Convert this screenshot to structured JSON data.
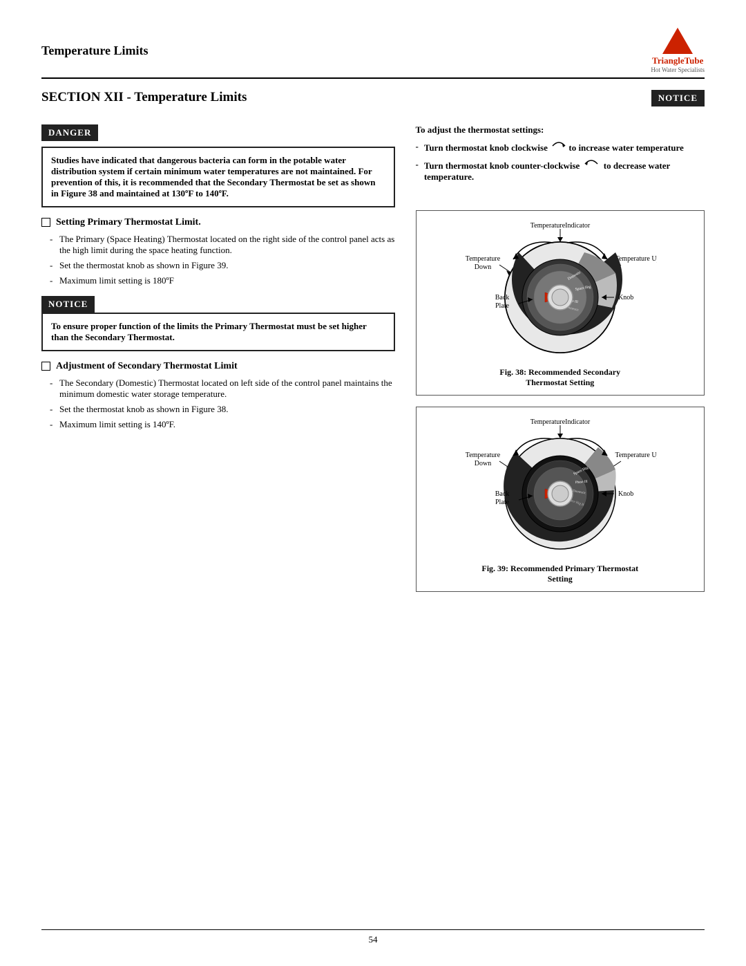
{
  "header": {
    "title": "Temperature Limits"
  },
  "logo": {
    "main": "TriangleTube",
    "sub": "Hot Water Specialists"
  },
  "section": {
    "title": "SECTION XII - Temperature Limits"
  },
  "danger": {
    "label": "DANGER",
    "text": "Studies have indicated that dangerous bacteria can form in the potable water distribution system if certain minimum water temperatures are not maintained. For prevention of this, it is recommended that the Secondary Thermostat be set as shown in Figure 38 and maintained at 130ºF to 140ºF."
  },
  "primary_setting": {
    "heading": "Setting  Primary Thermostat Limit.",
    "bullets": [
      "The Primary (Space Heating) Thermostat located on the right side of the control panel acts as the high limit during the space heating function.",
      "Set the thermostat knob as shown in Figure 39.",
      "Maximum limit setting is 180ºF"
    ]
  },
  "notice_left": {
    "label": "NOTICE",
    "text": "To ensure proper function of the limits the Primary Thermostat must be set higher than the Secondary Thermostat."
  },
  "secondary_adjustment": {
    "heading": "Adjustment of Secondary Thermostat Limit",
    "bullets": [
      "The Secondary (Domestic) Thermostat located on left side of the control panel maintains the minimum domestic water storage temperature.",
      "Set the thermostat knob as shown in Figure 38.",
      "Maximum limit setting is 140ºF."
    ]
  },
  "right_col": {
    "notice_label": "NOTICE",
    "adjust_heading": "To adjust the thermostat settings:",
    "bullet1_text": "Turn  thermostat  knob  clockwise to increase water temperature",
    "bullet2_text": "Turn  thermostat  knob  counter-clockwise       to decrease water temperature.",
    "fig38_caption_line1": "Fig. 38:  Recommended Secondary",
    "fig38_caption_line2": "Thermostat Setting",
    "fig39_caption_line1": "Fig. 39:  Recommended Primary Thermostat",
    "fig39_caption_line2": "Setting"
  },
  "footer": {
    "page_number": "54"
  }
}
